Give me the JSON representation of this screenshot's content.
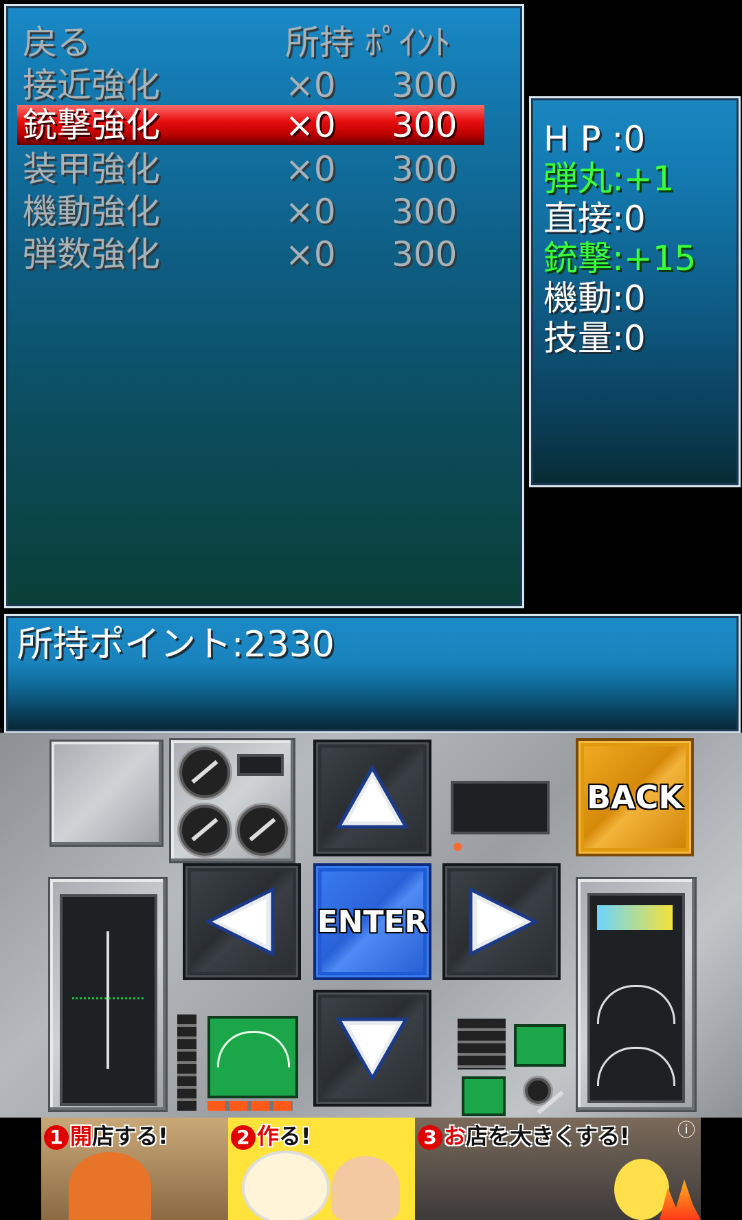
{
  "menu": {
    "header": {
      "back": "戻る",
      "owned_points": "所持 ﾎﾟｲﾝﾄ"
    },
    "items": [
      {
        "name": "接近強化",
        "owned": "×0",
        "cost": "300"
      },
      {
        "name": "銃撃強化",
        "owned": "×0",
        "cost": "300",
        "selected": true
      },
      {
        "name": "装甲強化",
        "owned": "×0",
        "cost": "300"
      },
      {
        "name": "機動強化",
        "owned": "×0",
        "cost": "300"
      },
      {
        "name": "弾数強化",
        "owned": "×0",
        "cost": "300"
      }
    ]
  },
  "stats": [
    {
      "label": "H P :0",
      "highlight": false
    },
    {
      "label": "弾丸:+1",
      "highlight": true
    },
    {
      "label": "直接:0",
      "highlight": false
    },
    {
      "label": "銃撃:+15",
      "highlight": true
    },
    {
      "label": "機動:0",
      "highlight": false
    },
    {
      "label": "技量:0",
      "highlight": false
    }
  ],
  "points": {
    "text": "所持ポイント:2330"
  },
  "controller": {
    "enter_label": "ENTER",
    "back_label": "BACK"
  },
  "ad": {
    "part1": {
      "num": "1",
      "highlight": "開",
      "rest": "店する!"
    },
    "part2": {
      "num": "2",
      "highlight": "作",
      "rest": "る!"
    },
    "part3": {
      "num": "3",
      "highlight": "お",
      "rest": "店を大きくする!"
    },
    "info_icon": "ⓘ"
  },
  "colors": {
    "highlight_green": "#3cff3c",
    "selected_red": "#e80f0f",
    "enter_blue": "#1e5bd6",
    "back_orange": "#e09a10"
  }
}
